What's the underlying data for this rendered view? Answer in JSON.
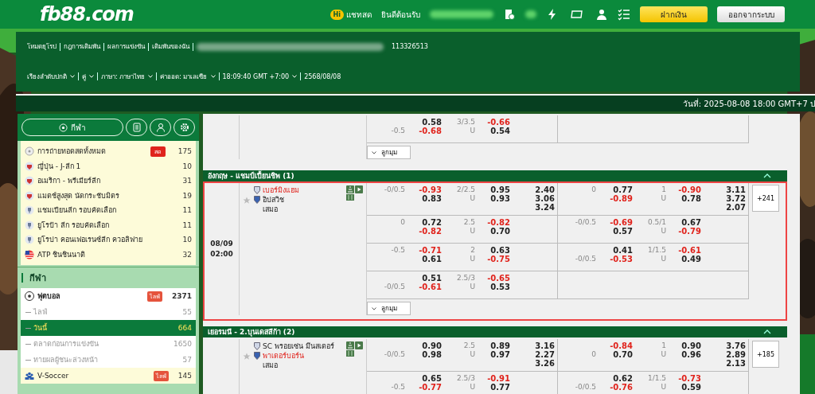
{
  "header": {
    "logo": "fb88.com",
    "chat_badge": "Hi",
    "chat": "แชทสด",
    "welcome": "ยินดีต้อนรับ",
    "deposit": "ฝากเงิน",
    "logout": "ออกจากระบบ"
  },
  "nav": {
    "links": [
      "โหมดยุโรป",
      "กฎการเดิมพัน",
      "ผลการแข่งขัน",
      "เดิมพันของฉัน"
    ],
    "account_id": "113326513",
    "settings": [
      {
        "label": "เรียงลำดับปกติ",
        "dropdown": true
      },
      {
        "label": "คู่",
        "dropdown": true
      },
      {
        "label": "ภาษา: ภาษาไทย",
        "dropdown": true
      },
      {
        "label": "ค่าออด: มาเลเซีย",
        "dropdown": true
      },
      {
        "label": "18:09:40 GMT +7:00",
        "dropdown": true
      },
      {
        "label": "2568/08/08",
        "dropdown": false
      }
    ]
  },
  "date_bar": "วันที่: 2025-08-08 18:00 GMT+7 ป",
  "sidebar": {
    "tabs": [
      {
        "kind": "sports",
        "label": "กีฬา"
      },
      {
        "kind": "betslip"
      },
      {
        "kind": "account"
      },
      {
        "kind": "settings"
      }
    ],
    "favorites": [
      {
        "kind": "broadcast",
        "name": "การถ่ายทอดสดทั้งหมด",
        "badge": "สด",
        "count": "175"
      },
      {
        "kind": "crest",
        "name": "ญี่ปุ่น - J-ลีก 1",
        "count": "10"
      },
      {
        "kind": "crest",
        "name": "อเมริกา - พรีเมียร์ลีก",
        "count": "31"
      },
      {
        "kind": "crest",
        "name": "แมตช์สูงสุด นัดกระชับมิตร",
        "count": "19"
      },
      {
        "kind": "trophy",
        "name": "แชมเปียนลีก รอบคัดเลือก",
        "count": "11"
      },
      {
        "kind": "trophy",
        "name": "ยูโรป้า ลีก รอบคัดเลือก",
        "count": "11"
      },
      {
        "kind": "trophy",
        "name": "ยูโรปา คอนเฟอเรนซ์ลีก ควอลิฟาย",
        "count": "10"
      },
      {
        "kind": "flag",
        "name": "ATP ชินชินนาติ",
        "count": "32"
      }
    ],
    "sports_title": "กีฬา",
    "sports": [
      {
        "kind": "soccer",
        "name": "ฟุตบอล",
        "badge": "ไลฟ์",
        "count": "2371",
        "expanded": true,
        "children": [
          {
            "name": "ไลฟ์",
            "count": "55",
            "selected": false
          },
          {
            "name": "วันนี้",
            "count": "664",
            "selected": true
          },
          {
            "name": "ตลาดก่อนการแข่งขัน",
            "count": "1650",
            "selected": false
          },
          {
            "name": "ทายผลผู้ชนะล่วงหน้า",
            "count": "57",
            "selected": false
          }
        ]
      },
      {
        "kind": "vsoccer",
        "name": "V-Soccer",
        "badge": "ไลฟ์",
        "count": "145",
        "expanded": false
      }
    ]
  },
  "previous_match": {
    "extra": "ลูกมุม",
    "rows": [
      {
        "ft": {
          "hdp": {
            "line": "-0.5",
            "line_on_away": true,
            "home": "0.58",
            "away": "-0.68"
          },
          "ou": {
            "line": "3/3.5",
            "label": "U",
            "over": "-0.66",
            "under": "0.54"
          }
        }
      }
    ]
  },
  "leagues": [
    {
      "title": "อังกฤษ - แชมป์เปี้ยนชิพ (1)",
      "expanded": true,
      "matches": [
        {
          "date": "08/09",
          "time": "02:00",
          "home": "เบอร์มิงแฮม",
          "away": "อิปสวิช",
          "draw": "เสมอ",
          "home_favorite": true,
          "starred": false,
          "highlighted": true,
          "more": "+241",
          "extra": "ลูกมุม",
          "rows": [
            {
              "ft": {
                "hdp": {
                  "line": "-0/0.5",
                  "line_on_away": false,
                  "home": "-0.93",
                  "away": "0.83"
                },
                "ou": {
                  "line": "2/2.5",
                  "label": "U",
                  "over": "0.95",
                  "under": "0.93"
                },
                "x12": [
                  "2.40",
                  "3.06",
                  "3.24"
                ]
              },
              "ht": {
                "hdp": {
                  "line": "0",
                  "line_on_away": false,
                  "home": "0.77",
                  "away": "-0.89"
                },
                "ou": {
                  "line": "1",
                  "label": "U",
                  "over": "-0.90",
                  "under": "0.78"
                },
                "x12": [
                  "3.11",
                  "3.72",
                  "2.07"
                ]
              }
            },
            {
              "ft": {
                "hdp": {
                  "line": "0",
                  "line_on_away": false,
                  "home": "0.72",
                  "away": "-0.82"
                },
                "ou": {
                  "line": "2.5",
                  "label": "U",
                  "over": "-0.82",
                  "under": "0.70"
                }
              },
              "ht": {
                "hdp": {
                  "line": "-0/0.5",
                  "line_on_away": false,
                  "home": "-0.69",
                  "away": "0.57"
                },
                "ou": {
                  "line": "0.5/1",
                  "label": "U",
                  "over": "0.67",
                  "under": "-0.79"
                }
              }
            },
            {
              "ft": {
                "hdp": {
                  "line": "-0.5",
                  "line_on_away": false,
                  "home": "-0.71",
                  "away": "0.61"
                },
                "ou": {
                  "line": "2",
                  "label": "U",
                  "over": "0.63",
                  "under": "-0.75"
                }
              },
              "ht": {
                "hdp": {
                  "line": "-0/0.5",
                  "line_on_away": true,
                  "home": "0.41",
                  "away": "-0.53"
                },
                "ou": {
                  "line": "1/1.5",
                  "label": "U",
                  "over": "-0.61",
                  "under": "0.49"
                }
              }
            },
            {
              "ft": {
                "hdp": {
                  "line": "-0/0.5",
                  "line_on_away": true,
                  "home": "0.51",
                  "away": "-0.61"
                },
                "ou": {
                  "line": "2.5/3",
                  "label": "U",
                  "over": "-0.65",
                  "under": "0.53"
                }
              }
            }
          ]
        }
      ]
    },
    {
      "title": "เยอรมนี - 2.บุนเดสลีก้า (2)",
      "expanded": true,
      "matches": [
        {
          "home": "SC พรอยเซ่น มึนสเตอร์",
          "away": "พาเดอร์บอร์น",
          "draw": "เสมอ",
          "home_favorite": false,
          "starred": false,
          "highlighted": false,
          "more": "+185",
          "rows": [
            {
              "ft": {
                "hdp": {
                  "line": "-0/0.5",
                  "line_on_away": true,
                  "home": "0.90",
                  "away": "0.98"
                },
                "ou": {
                  "line": "2.5",
                  "label": "U",
                  "over": "0.89",
                  "under": "0.97"
                },
                "x12": [
                  "3.16",
                  "2.27",
                  "3.26"
                ]
              },
              "ht": {
                "hdp": {
                  "line": "0",
                  "line_on_away": true,
                  "home": "-0.84",
                  "away": "0.70"
                },
                "ou": {
                  "line": "1",
                  "label": "U",
                  "over": "0.90",
                  "under": "0.96"
                },
                "x12": [
                  "3.76",
                  "2.89",
                  "2.13"
                ]
              }
            },
            {
              "ft": {
                "hdp": {
                  "line": "-0.5",
                  "line_on_away": true,
                  "home": "0.65",
                  "away": "-0.77"
                },
                "ou": {
                  "line": "2.5/3",
                  "label": "U",
                  "over": "-0.91",
                  "under": "0.77"
                }
              },
              "ht": {
                "hdp": {
                  "line": "-0/0.5",
                  "line_on_away": true,
                  "home": "0.62",
                  "away": "-0.76"
                },
                "ou": {
                  "line": "1/1.5",
                  "label": "U",
                  "over": "-0.73",
                  "under": "0.59"
                }
              }
            }
          ]
        }
      ]
    }
  ]
}
